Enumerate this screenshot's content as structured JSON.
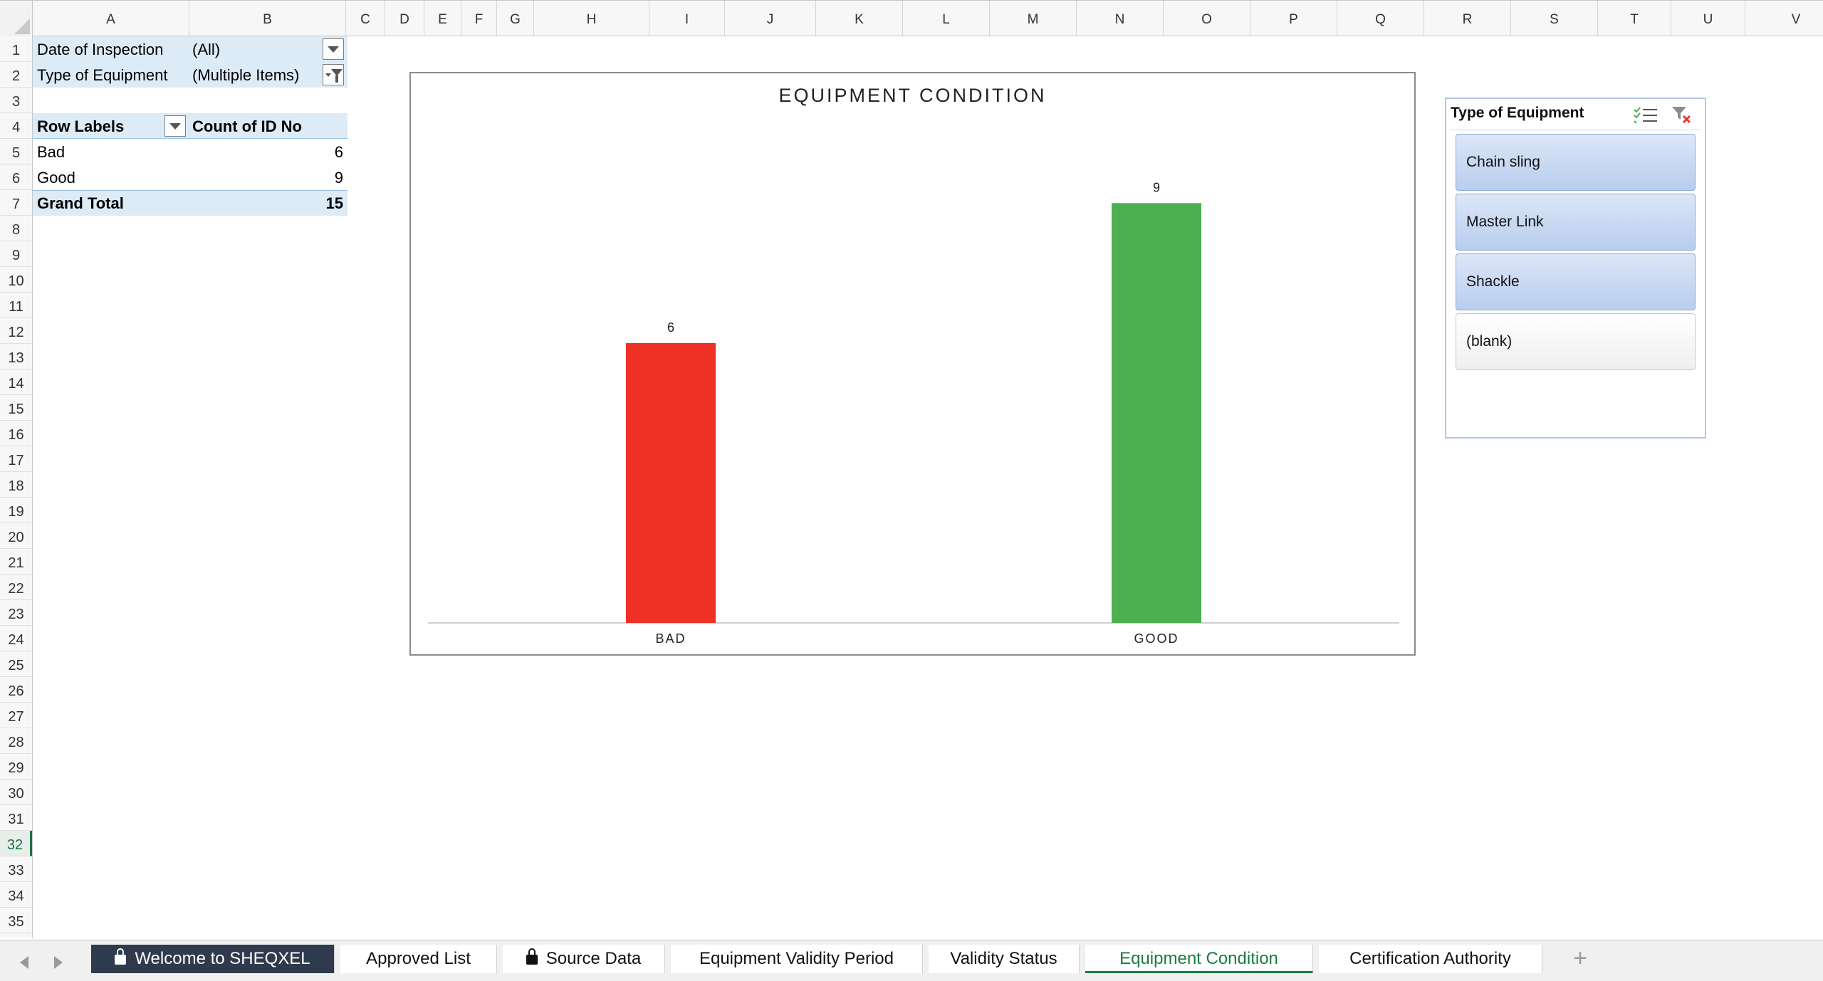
{
  "columns": [
    {
      "label": "A",
      "w": 220
    },
    {
      "label": "B",
      "w": 220
    },
    {
      "label": "C",
      "w": 55
    },
    {
      "label": "D",
      "w": 55
    },
    {
      "label": "E",
      "w": 52
    },
    {
      "label": "F",
      "w": 50
    },
    {
      "label": "G",
      "w": 52
    },
    {
      "label": "H",
      "w": 162
    },
    {
      "label": "I",
      "w": 106
    },
    {
      "label": "J",
      "w": 128
    },
    {
      "label": "K",
      "w": 122
    },
    {
      "label": "L",
      "w": 122
    },
    {
      "label": "M",
      "w": 122
    },
    {
      "label": "N",
      "w": 122
    },
    {
      "label": "O",
      "w": 122
    },
    {
      "label": "P",
      "w": 122
    },
    {
      "label": "Q",
      "w": 122
    },
    {
      "label": "R",
      "w": 122
    },
    {
      "label": "S",
      "w": 122
    },
    {
      "label": "T",
      "w": 103
    },
    {
      "label": "U",
      "w": 104
    },
    {
      "label": "V",
      "w": 143
    }
  ],
  "rows": [
    "1",
    "2",
    "3",
    "4",
    "5",
    "6",
    "7",
    "8",
    "9",
    "10",
    "11",
    "12",
    "13",
    "14",
    "15",
    "16",
    "17",
    "18",
    "19",
    "20",
    "21",
    "22",
    "23",
    "24",
    "25",
    "26",
    "27",
    "28",
    "29",
    "30",
    "31",
    "32",
    "33",
    "34",
    "35"
  ],
  "active_row": "32",
  "pivot": {
    "filter1_label": "Date of Inspection",
    "filter1_value": "(All)",
    "filter2_label": "Type of Equipment",
    "filter2_value": "(Multiple Items)",
    "header_row_labels": "Row Labels",
    "header_count": "Count of ID No",
    "rows": [
      {
        "label": "Bad",
        "value": "6"
      },
      {
        "label": "Good",
        "value": "9"
      }
    ],
    "total_label": "Grand Total",
    "total_value": "15"
  },
  "chart_data": {
    "type": "bar",
    "title": "EQUIPMENT CONDITION",
    "categories": [
      "BAD",
      "GOOD"
    ],
    "values": [
      6,
      9
    ],
    "colors": [
      "#ee3124",
      "#4caf50"
    ],
    "ylim": [
      0,
      10.5
    ],
    "grid": false
  },
  "slicer": {
    "title": "Type of Equipment",
    "items": [
      {
        "label": "Chain sling",
        "selected": true
      },
      {
        "label": "Master Link",
        "selected": true
      },
      {
        "label": "Shackle",
        "selected": true
      },
      {
        "label": "(blank)",
        "selected": false
      }
    ]
  },
  "tabs": [
    {
      "label": "Welcome to SHEQXEL",
      "locked": true,
      "style": "dark",
      "w": 342
    },
    {
      "label": "Approved List",
      "locked": false,
      "style": "",
      "w": 220
    },
    {
      "label": "Source Data",
      "locked": true,
      "style": "",
      "w": 228
    },
    {
      "label": "Equipment Validity Period",
      "locked": false,
      "style": "",
      "w": 354
    },
    {
      "label": "Validity Status",
      "locked": false,
      "style": "",
      "w": 212
    },
    {
      "label": "Equipment Condition",
      "locked": false,
      "style": "active",
      "w": 320
    },
    {
      "label": "Certification Authority",
      "locked": false,
      "style": "",
      "w": 314
    }
  ],
  "add_tab": "+"
}
